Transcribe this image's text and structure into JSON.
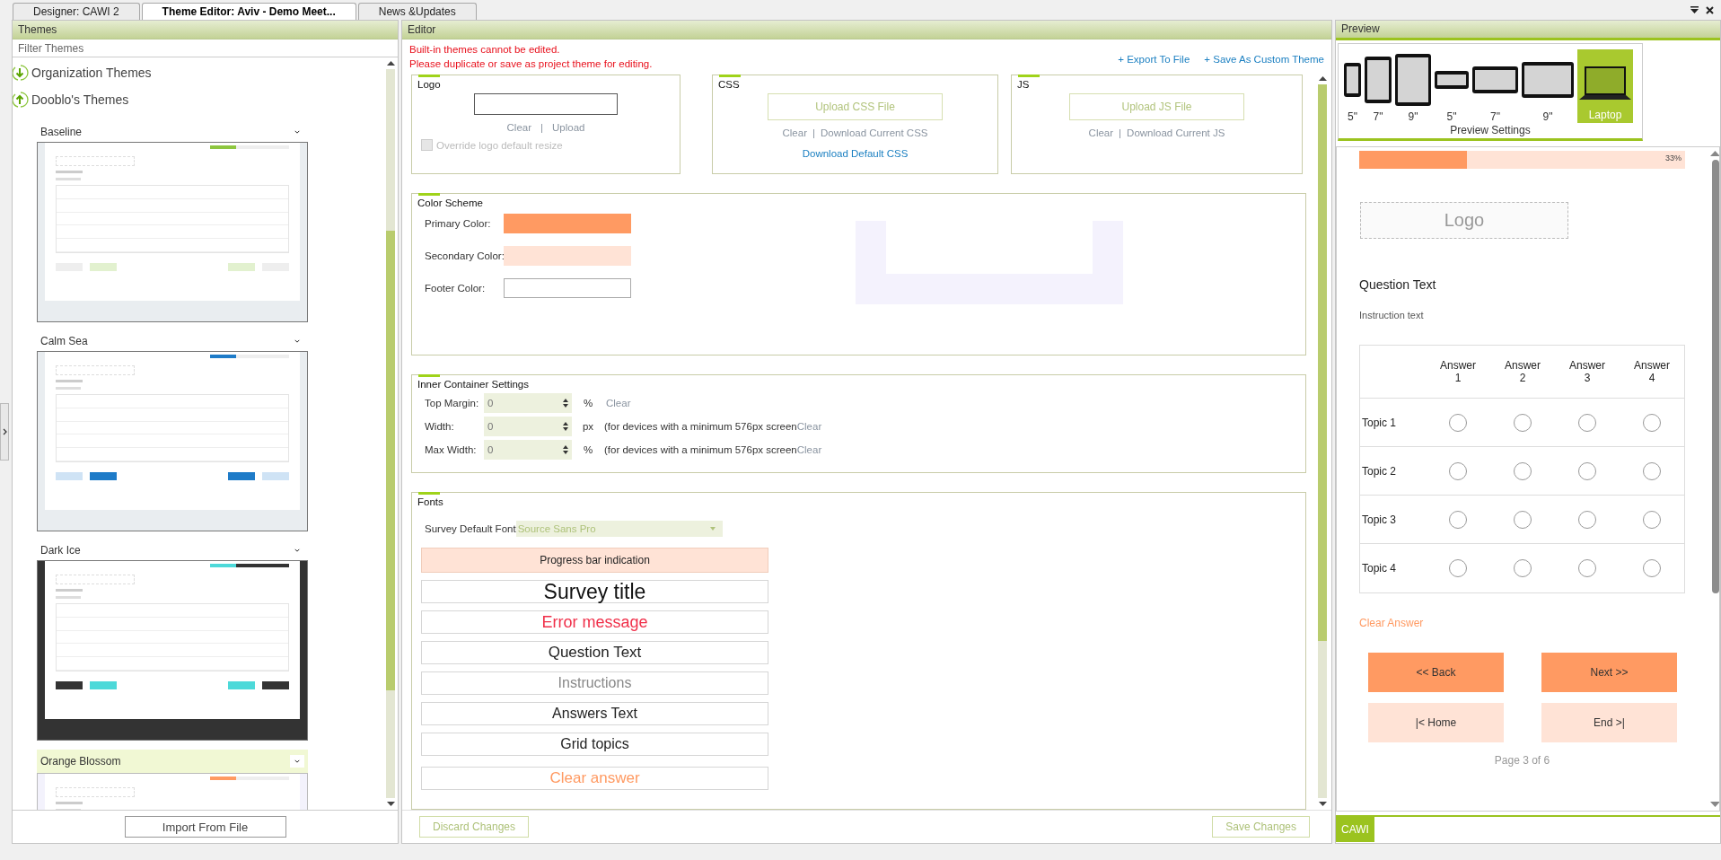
{
  "tabs": [
    {
      "label": "Designer: CAWI 2",
      "selected": false
    },
    {
      "label": "Theme Editor: Aviv - Demo Meet...",
      "selected": true
    },
    {
      "label": "News &Updates",
      "selected": false
    }
  ],
  "themes_panel": {
    "title": "Themes",
    "filter": {
      "placeholder": "Filter Themes"
    },
    "groups": [
      {
        "label": "Organization Themes",
        "expanded": false
      },
      {
        "label": "Dooblo's Themes",
        "expanded": true
      }
    ],
    "themes": [
      {
        "name": "Baseline",
        "color": "#8dc63f",
        "kind": "light",
        "selected": false
      },
      {
        "name": "Calm Sea",
        "color": "#1e7bc8",
        "kind": "light",
        "selected": false
      },
      {
        "name": "Dark Ice",
        "color": "#4dd9d9",
        "kind": "dark",
        "selected": false
      },
      {
        "name": "Orange Blossom",
        "color": "#ff9a62",
        "kind": "tinted",
        "selected": true
      }
    ],
    "import_button": "Import From File"
  },
  "editor": {
    "title": "Editor",
    "notice": [
      "Built-in themes cannot be edited.",
      "Please duplicate or save as project theme for editing."
    ],
    "actions": [
      "+ Export To File",
      "+ Save As Custom Theme"
    ],
    "logo": {
      "title": "Logo",
      "links": [
        "Clear",
        "Upload"
      ],
      "separator": "|",
      "override": {
        "label": "Override logo default resize",
        "checked": false,
        "disabled": true
      }
    },
    "css": {
      "title": "CSS",
      "upload_button": "Upload CSS File",
      "links": [
        "Clear",
        "Download Current CSS"
      ],
      "separator": "|",
      "default_link": "Download Default CSS"
    },
    "js": {
      "title": "JS",
      "upload_button": "Upload JS File",
      "links": [
        "Clear",
        "Download Current JS"
      ],
      "separator": "|"
    },
    "color_scheme": {
      "title": "Color Scheme",
      "colors": [
        {
          "label": "Primary Color:",
          "color": "#ff9a62"
        },
        {
          "label": "Secondary Color:",
          "color": "#ffe3d6"
        },
        {
          "label": "Footer Color:",
          "color": "#ffffff"
        }
      ]
    },
    "inner_container": {
      "title": "Inner Container Settings",
      "rows": [
        {
          "label": "Top Margin:",
          "value": "0",
          "unit": "%",
          "clear": "Clear"
        },
        {
          "label": "Width:",
          "value": "0",
          "unit": "px",
          "note": "(for devices with a minimum 576px screen",
          "clear": "Clear"
        },
        {
          "label": "Max Width:",
          "value": "0",
          "unit": "%",
          "note": "(for devices with a minimum 576px screen",
          "clear": "Clear"
        }
      ]
    },
    "fonts": {
      "title": "Fonts",
      "default_font_label": "Survey Default Font",
      "default_font": "Source Sans Pro",
      "samples": [
        {
          "text": "Progress bar indication",
          "kind": "progress"
        },
        {
          "text": "Survey title",
          "kind": "title"
        },
        {
          "text": "Error message",
          "kind": "error"
        },
        {
          "text": "Question Text",
          "kind": "question"
        },
        {
          "text": "Instructions",
          "kind": "instructions"
        },
        {
          "text": "Answers Text",
          "kind": "answers"
        },
        {
          "text": "Grid topics",
          "kind": "topics"
        },
        {
          "text": "Clear answer",
          "kind": "clear"
        }
      ]
    },
    "discard_button": "Discard Changes",
    "save_button": "Save Changes"
  },
  "preview": {
    "title": "Preview",
    "devices": [
      {
        "label": "5\"",
        "kind": "portrait",
        "selected": false
      },
      {
        "label": "7\"",
        "kind": "portrait",
        "selected": false
      },
      {
        "label": "9\"",
        "kind": "portrait",
        "selected": false
      },
      {
        "label": "5\"",
        "kind": "landscape",
        "selected": false
      },
      {
        "label": "7\"",
        "kind": "landscape",
        "selected": false
      },
      {
        "label": "9\"",
        "kind": "landscape",
        "selected": false
      },
      {
        "label": "Laptop",
        "kind": "laptop",
        "selected": true
      }
    ],
    "settings_label": "Preview Settings",
    "survey": {
      "progress": {
        "level": 0.33,
        "reading": "33%"
      },
      "logo": "Logo",
      "question": "Question Text",
      "instruction": "Instruction text",
      "columns": [
        "Answer 1",
        "Answer 2",
        "Answer 3",
        "Answer 4"
      ],
      "rows": [
        {
          "topic": "Topic 1",
          "choices": [
            {
              "selected": false
            },
            {
              "selected": false
            },
            {
              "selected": false
            },
            {
              "selected": false
            }
          ]
        },
        {
          "topic": "Topic 2",
          "choices": [
            {
              "selected": false
            },
            {
              "selected": false
            },
            {
              "selected": false
            },
            {
              "selected": false
            }
          ]
        },
        {
          "topic": "Topic 3",
          "choices": [
            {
              "selected": false
            },
            {
              "selected": false
            },
            {
              "selected": false
            },
            {
              "selected": false
            }
          ]
        },
        {
          "topic": "Topic 4",
          "choices": [
            {
              "selected": false
            },
            {
              "selected": false
            },
            {
              "selected": false
            },
            {
              "selected": false
            }
          ]
        }
      ],
      "clear_answer": "Clear Answer",
      "buttons": [
        {
          "label": "<< Back",
          "kind": "primary"
        },
        {
          "label": "Next >>",
          "kind": "primary"
        },
        {
          "label": "|< Home",
          "kind": "secondary"
        },
        {
          "label": "End >|",
          "kind": "secondary"
        }
      ],
      "page": "Page 3 of 6"
    },
    "bottom_tabs": [
      {
        "label": "CAWI",
        "selected": true
      }
    ]
  }
}
